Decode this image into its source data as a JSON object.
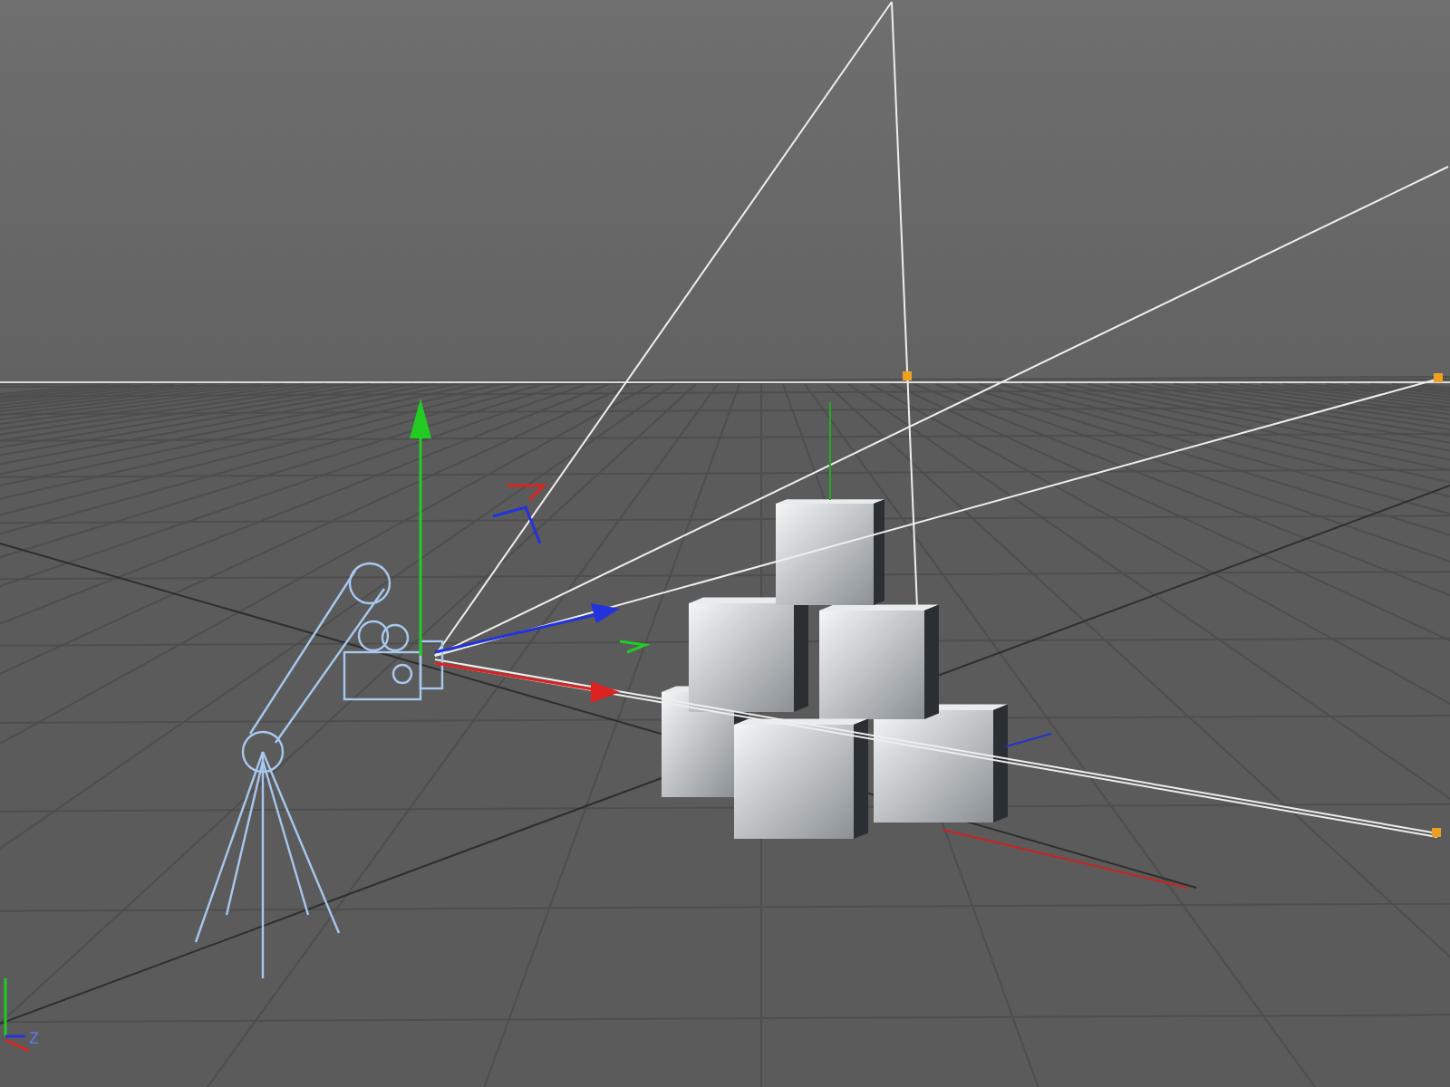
{
  "viewport": {
    "axis_indicator": {
      "label": "Z"
    }
  }
}
